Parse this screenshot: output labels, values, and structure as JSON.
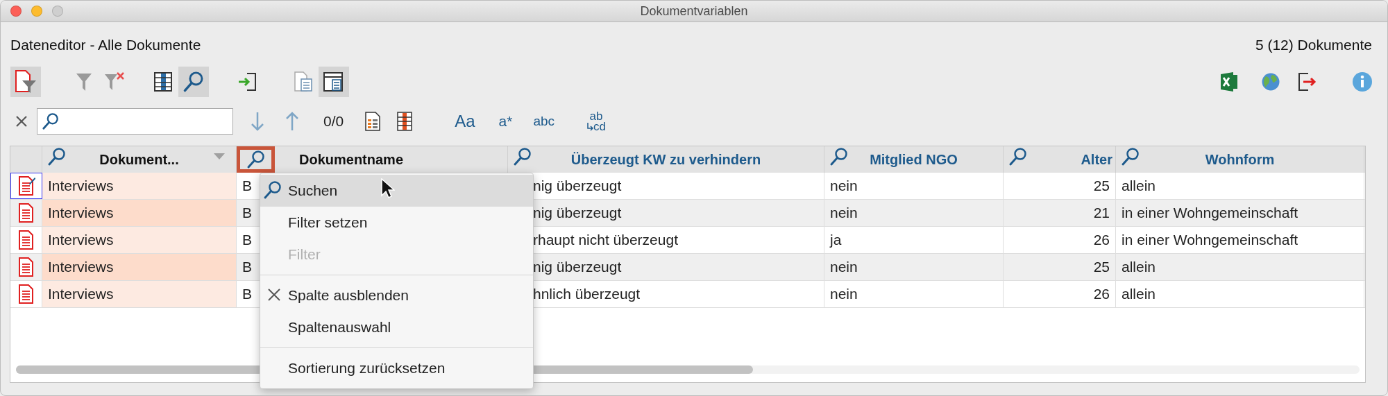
{
  "window": {
    "title": "Dokumentvariablen"
  },
  "header": {
    "title": "Dateneditor - Alle Dokumente",
    "count": "5 (12) Dokumente"
  },
  "toolbar": [
    {
      "kind": "doc-filter",
      "selected": true
    },
    {
      "kind": "filter",
      "selected": false
    },
    {
      "kind": "filter-clear",
      "selected": false
    },
    {
      "kind": "columns",
      "selected": false
    },
    {
      "kind": "search",
      "selected": true
    },
    {
      "kind": "import",
      "selected": false
    },
    {
      "kind": "doc-list",
      "selected": false
    },
    {
      "kind": "doc-window",
      "selected": true
    }
  ],
  "toolbar_right": [
    {
      "kind": "excel"
    },
    {
      "kind": "globe"
    },
    {
      "kind": "export"
    },
    {
      "kind": "info"
    }
  ],
  "search_bar": {
    "counter": "0/0",
    "options": [
      "Aa",
      "a*",
      "abc"
    ],
    "replace": {
      "top": "ab",
      "bottom": "cd"
    }
  },
  "table": {
    "columns": [
      {
        "label": "Dokument...",
        "kind": "system",
        "sorted": true,
        "highlighted": false
      },
      {
        "label": "Dokumentname",
        "kind": "system",
        "sorted": false,
        "highlighted": true
      },
      {
        "label": "Überzeugt KW zu verhindern",
        "kind": "variable",
        "sorted": false,
        "highlighted": false
      },
      {
        "label": "Mitglied NGO",
        "kind": "variable",
        "sorted": false,
        "highlighted": false
      },
      {
        "label": "Alter",
        "kind": "variable",
        "sorted": false,
        "highlighted": false
      },
      {
        "label": "Wohnform",
        "kind": "variable",
        "sorted": false,
        "highlighted": false
      }
    ],
    "rows": [
      {
        "focused": true,
        "cells": [
          "Interviews",
          "B",
          "nig überzeugt",
          "nein",
          "25",
          "allein"
        ]
      },
      {
        "focused": false,
        "cells": [
          "Interviews",
          "B",
          "nig überzeugt",
          "nein",
          "21",
          "in einer Wohngemeinschaft"
        ]
      },
      {
        "focused": false,
        "cells": [
          "Interviews",
          "B",
          "rhaupt nicht überzeugt",
          "ja",
          "26",
          "in einer Wohngemeinschaft"
        ]
      },
      {
        "focused": false,
        "cells": [
          "Interviews",
          "B",
          "nig überzeugt",
          "nein",
          "25",
          "allein"
        ]
      },
      {
        "focused": false,
        "cells": [
          "Interviews",
          "B",
          "hnlich überzeugt",
          "nein",
          "26",
          "allein"
        ]
      }
    ]
  },
  "context_menu": [
    {
      "kind": "search",
      "label": "Suchen",
      "selected": true,
      "disabled": false
    },
    {
      "kind": "plain",
      "label": "Filter setzen",
      "selected": false,
      "disabled": false
    },
    {
      "kind": "plain",
      "label": "Filter",
      "selected": false,
      "disabled": true
    },
    {
      "kind": "separator"
    },
    {
      "kind": "hide",
      "label": "Spalte ausblenden",
      "selected": false,
      "disabled": false
    },
    {
      "kind": "plain",
      "label": "Spaltenauswahl",
      "selected": false,
      "disabled": false
    },
    {
      "kind": "separator"
    },
    {
      "kind": "plain",
      "label": "Sortierung zurücksetzen",
      "selected": false,
      "disabled": false
    }
  ]
}
